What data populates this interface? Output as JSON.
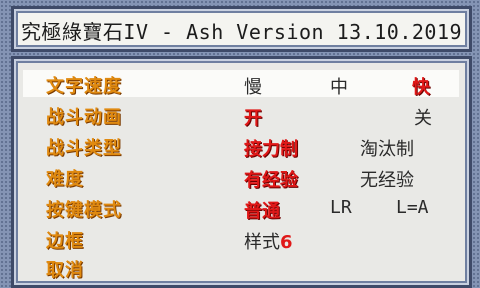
{
  "title": "究極綠寶石IV - Ash Version 13.10.2019",
  "menu": {
    "rows": [
      {
        "label": "文字速度",
        "options": [
          "慢",
          "中",
          "快"
        ],
        "selected_index": 2
      },
      {
        "label": "战斗动画",
        "options": [
          "开",
          "关"
        ],
        "selected_index": 0
      },
      {
        "label": "战斗类型",
        "options": [
          "接力制",
          "淘汰制"
        ],
        "selected_index": 0
      },
      {
        "label": "难度",
        "options": [
          "有经验",
          "无经验"
        ],
        "selected_index": 0
      },
      {
        "label": "按键模式",
        "options": [
          "普通",
          "LR",
          "L=A"
        ],
        "selected_index": 0
      },
      {
        "label": "边框",
        "value_prefix": "样式",
        "value_number": "6"
      },
      {
        "label": "取消"
      }
    ],
    "highlighted_row": 0
  },
  "colors": {
    "label": "#e08a10",
    "selected_option": "#e01818",
    "highlight": "#fbfbf9"
  }
}
